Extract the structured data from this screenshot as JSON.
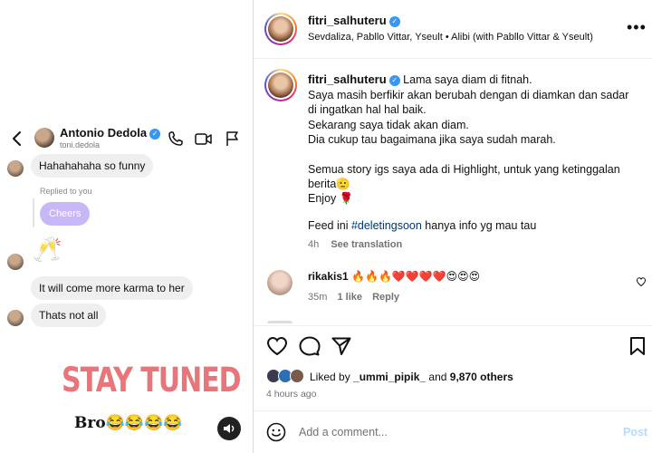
{
  "dm": {
    "contact_name": "Antonio Dedola",
    "contact_username": "toni.dedola",
    "messages": [
      {
        "text": "Hahahahaha so funny"
      },
      {
        "replied_label": "Replied to you",
        "reply_text": "Cheers"
      },
      {
        "emoji": "🥂"
      },
      {
        "text": "It will come more karma to her"
      },
      {
        "text": "Thats not all"
      }
    ],
    "sticker_text": "STAY TUNED",
    "bro_text": "Bro😂😂😂😂",
    "icons": [
      "back-arrow-icon",
      "phone-icon",
      "video-icon",
      "flag-icon",
      "sound-icon"
    ]
  },
  "post": {
    "username": "fitri_salhuteru",
    "audio": "Sevdaliza, Pabllo Vittar, Yseult • Alibi (with Pabllo Vittar & Yseult)",
    "more": "•••",
    "caption": {
      "first_line": "Lama saya diam di fitnah.",
      "lines": [
        "Saya masih berfikir akan berubah dengan di diamkan dan sadar",
        "di ingatkan hal hal baik.",
        "Sekarang saya tidak akan diam.",
        "Dia cukup tau bagaimana jika saya sudah marah."
      ],
      "lines2": [
        "Semua story igs saya ada di Highlight, untuk yang ketinggalan",
        "berita🫡",
        "Enjoy 🌹"
      ],
      "feed_prefix": "Feed ini ",
      "hashtag": "#deletingsoon",
      "feed_suffix": " hanya info yg mau tau"
    },
    "caption_time": "4h",
    "see_translation": "See translation",
    "comment": {
      "username": "rikakis1",
      "text": "🔥🔥🔥❤️❤️❤️❤️😍😍😍",
      "time": "35m",
      "likes": "1 like",
      "reply": "Reply"
    },
    "likes_prefix": "Liked by ",
    "liked_by": "_ummi_pipik_",
    "likes_middle": " and ",
    "others": "9,870 others",
    "posted": "4 hours ago",
    "add_comment_placeholder": "Add a comment...",
    "post_button": "Post",
    "accent": "#3897f0"
  }
}
